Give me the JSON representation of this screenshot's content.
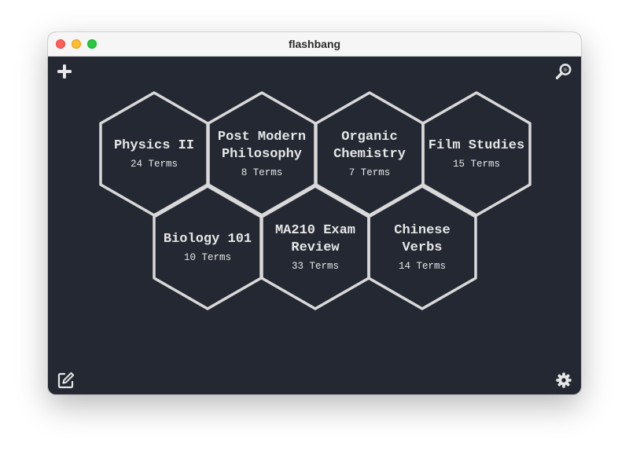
{
  "window": {
    "title": "flashbang"
  },
  "toolbar": {
    "add_icon": "plus-icon",
    "search_icon": "search-icon",
    "edit_icon": "edit-icon",
    "settings_icon": "gear-icon"
  },
  "decks": [
    {
      "name": "Physics II",
      "count": "24 Terms"
    },
    {
      "name": "Post Modern Philosophy",
      "count": "8 Terms"
    },
    {
      "name": "Organic Chemistry",
      "count": "7 Terms"
    },
    {
      "name": "Film Studies",
      "count": "15 Terms"
    },
    {
      "name": "Biology 101",
      "count": "10 Terms"
    },
    {
      "name": "MA210 Exam Review",
      "count": "33 Terms"
    },
    {
      "name": "Chinese Verbs",
      "count": "14 Terms"
    }
  ],
  "colors": {
    "background": "#232833",
    "hex_stroke": "#d9d9d9",
    "text": "#e6e6e6"
  }
}
